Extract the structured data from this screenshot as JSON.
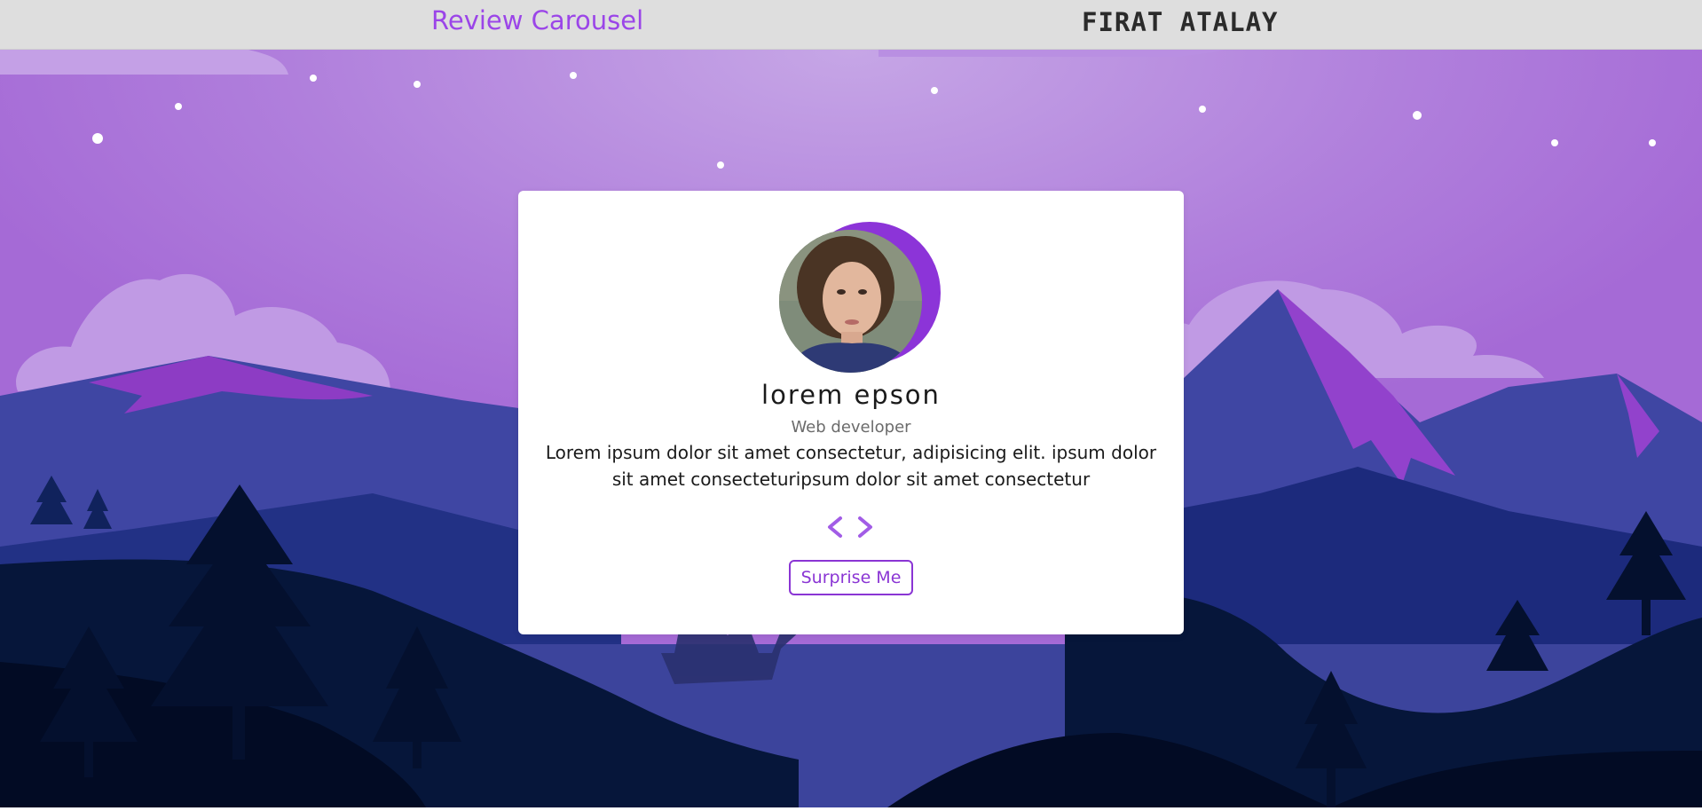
{
  "header": {
    "title": "Review Carousel",
    "author": "FIRAT ATALAY",
    "title_color": "#9b45e8",
    "background": "#dedede"
  },
  "review": {
    "name": "lorem epson",
    "role": "Web developer",
    "text": "Lorem ipsum dolor sit amet consectetur, adipisicing elit. ipsum dolor sit amet consecteturipsum dolor sit amet consectetur",
    "prev_icon": "chevron-left-icon",
    "next_icon": "chevron-right-icon",
    "surprise_label": "Surprise Me",
    "accent_color": "#8a35d4"
  },
  "background_scene": {
    "sky_color": "#a874d9",
    "mountain_color": "#3c449c",
    "ground_color": "#020b24"
  }
}
